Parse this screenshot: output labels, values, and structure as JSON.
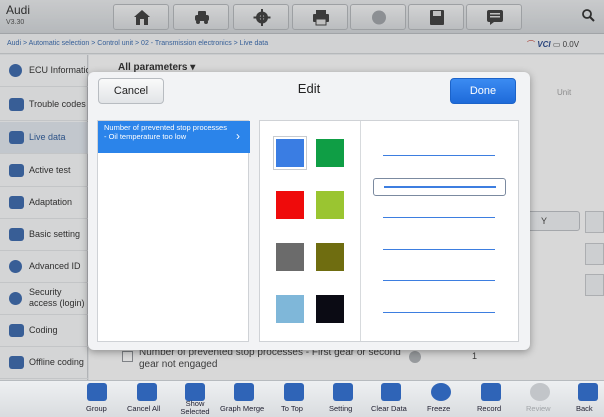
{
  "header": {
    "title": "Audi",
    "version": "V3.30",
    "toolbar_icons": [
      "home-icon",
      "car-icon",
      "gear-icon",
      "print-icon",
      "help-icon",
      "save-icon",
      "message-icon"
    ],
    "search_icon": "search-icon"
  },
  "breadcrumb": {
    "path": "Audi > Automatic selection > Control unit > 02 - Transmission electronics > Live data",
    "status": "VCI",
    "battery": "0.0V"
  },
  "sidebar": {
    "items": [
      {
        "label": "ECU Information",
        "icon": "info-icon"
      },
      {
        "label": "Trouble codes",
        "icon": "engine-icon"
      },
      {
        "label": "Live data",
        "icon": "chart-icon"
      },
      {
        "label": "Active test",
        "icon": "car-icon"
      },
      {
        "label": "Adaptation",
        "icon": "car-icon"
      },
      {
        "label": "Basic setting",
        "icon": "car-icon"
      },
      {
        "label": "Advanced ID",
        "icon": "info-icon"
      },
      {
        "label": "Security access (login)",
        "icon": "key-icon"
      },
      {
        "label": "Coding",
        "icon": "code-icon"
      },
      {
        "label": "Offline coding",
        "icon": "code-icon"
      }
    ]
  },
  "main": {
    "filter_label": "All parameters",
    "unit_header": "Unit",
    "row_text": "Number of prevented stop processes - First gear or second gear not engaged",
    "row_value": "1",
    "tool_label": "Y"
  },
  "dialog": {
    "title": "Edit",
    "cancel_label": "Cancel",
    "done_label": "Done",
    "parameter": "Number of prevented stop processes - Oil temperature too low",
    "colors": [
      "#3a7de3",
      "#0f9e45",
      "#ef0b0b",
      "#9ac531",
      "#6b6b6b",
      "#6f6d10",
      "#7fb7d9",
      "#0b0b14"
    ],
    "selected_color": "#3a7de3",
    "line_styles": [
      "thin",
      "thin",
      "thin",
      "thin",
      "thin",
      "thin"
    ],
    "selected_line": 1
  },
  "bottombar": {
    "items": [
      {
        "label": "Group",
        "icon": "plus-icon"
      },
      {
        "label": "Cancel All",
        "icon": "list-icon"
      },
      {
        "label": "Show Selected",
        "icon": "grid-icon"
      },
      {
        "label": "Graph Merge",
        "icon": "graph-icon"
      },
      {
        "label": "To Top",
        "icon": "arrow-up-icon"
      },
      {
        "label": "Setting",
        "icon": "setting-icon"
      },
      {
        "label": "Clear Data",
        "icon": "trash-icon"
      },
      {
        "label": "Freeze",
        "icon": "snowflake-icon"
      },
      {
        "label": "Record",
        "icon": "record-icon"
      },
      {
        "label": "Review",
        "icon": "play-icon"
      },
      {
        "label": "Back",
        "icon": "back-icon"
      }
    ]
  }
}
